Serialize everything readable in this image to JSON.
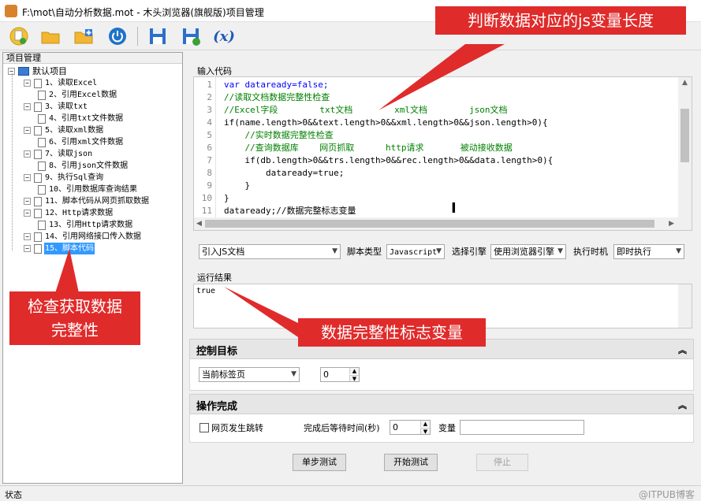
{
  "window": {
    "title": "F:\\mot\\自动分析数据.mot  - 木头浏览器(旗舰版)项目管理"
  },
  "toolbar": {
    "items": [
      {
        "icon": "new-document-icon"
      },
      {
        "icon": "open-folder-icon"
      },
      {
        "icon": "add-folder-icon"
      },
      {
        "icon": "power-icon"
      },
      {
        "icon": "save-icon"
      },
      {
        "icon": "save-as-icon"
      },
      {
        "icon": "variable-icon",
        "label": "(x)"
      }
    ]
  },
  "tree": {
    "header": "项目管理",
    "root": "默认项目",
    "items": [
      {
        "label": "1、读取Excel",
        "level": 1
      },
      {
        "label": "2、引用Excel数据",
        "level": 2
      },
      {
        "label": "3、读取txt",
        "level": 1
      },
      {
        "label": "4、引用txt文件数据",
        "level": 2
      },
      {
        "label": "5、读取xml数据",
        "level": 1
      },
      {
        "label": "6、引用xml文件数据",
        "level": 2
      },
      {
        "label": "7、读取json",
        "level": 1
      },
      {
        "label": "8、引用json文件数据",
        "level": 2
      },
      {
        "label": "9、执行Sql查询",
        "level": 1
      },
      {
        "label": "10、引用数据库查询结果",
        "level": 2
      },
      {
        "label": "11、脚本代码从网页抓取数据",
        "level": 1
      },
      {
        "label": "12、Http请求数据",
        "level": 1
      },
      {
        "label": "13、引用Http请求数据",
        "level": 2
      },
      {
        "label": "14、引用网络接口传入数据",
        "level": 1
      },
      {
        "label": "15、脚本代码",
        "level": 1,
        "selected": true
      }
    ]
  },
  "editor": {
    "group_label": "输入代码",
    "lines": [
      {
        "n": "1",
        "text": "var dataready=false;"
      },
      {
        "n": "2",
        "text": "//读取文档数据完整性检查"
      },
      {
        "n": "3",
        "text": "//Excel字段        txt文档        xml文档        json文档"
      },
      {
        "n": "4",
        "text": "if(name.length>0&&text.length>0&&xml.length>0&&json.length>0){"
      },
      {
        "n": "5",
        "text": "    //实时数据完整性检查"
      },
      {
        "n": "6",
        "text": "    //查询数据库    网页抓取      http请求       被动接收数据"
      },
      {
        "n": "7",
        "text": "    if(db.length>0&&trs.length>0&&rec.length>0&&data.length>0){"
      },
      {
        "n": "8",
        "text": "        dataready=true;"
      },
      {
        "n": "9",
        "text": "    }"
      },
      {
        "n": "10",
        "text": "}"
      },
      {
        "n": "11",
        "text": "dataready;//数据完整标志变量"
      }
    ]
  },
  "script_options": {
    "import_js": "引入JS文档",
    "script_type_label": "脚本类型",
    "script_type_value": "Javascript",
    "engine_label": "选择引擎",
    "engine_value": "使用浏览器引擎",
    "timing_label": "执行时机",
    "timing_value": "即时执行"
  },
  "result": {
    "label": "运行结果",
    "value": "true"
  },
  "control_target": {
    "title": "控制目标",
    "target_value": "当前标签页",
    "index_value": "0"
  },
  "operation_done": {
    "title": "操作完成",
    "jump_label": "网页发生跳转",
    "wait_label": "完成后等待时间(秒)",
    "wait_value": "0",
    "variable_label": "变量",
    "variable_value": ""
  },
  "buttons": {
    "step": "单步测试",
    "start": "开始测试",
    "stop": "停止"
  },
  "status": {
    "text": "状态",
    "watermark": "@ITPUB博客"
  },
  "callouts": {
    "top": "判断数据对应的js变量长度",
    "left": "检查获取数据\n完整性",
    "middle": "数据完整性标志变量"
  },
  "colors": {
    "callout": "#e02b2b",
    "selection": "#3399ff",
    "keyword": "#0000ff",
    "comment": "#008000"
  }
}
